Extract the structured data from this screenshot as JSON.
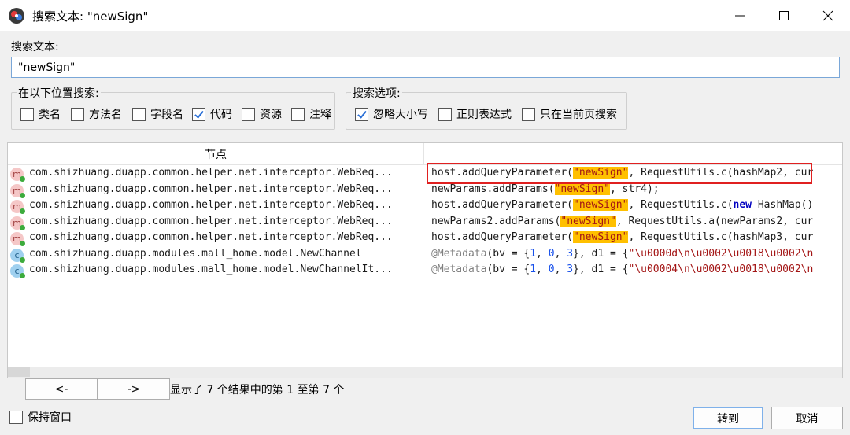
{
  "window": {
    "title": "搜索文本: \"newSign\"",
    "app_icon": "jadx-app-icon",
    "controls": {
      "minimize": "minimize-icon",
      "maximize": "maximize-icon",
      "close": "close-icon"
    }
  },
  "search": {
    "label": "搜索文本:",
    "value": "\"newSign\""
  },
  "location_group": {
    "title": "在以下位置搜索:",
    "options": [
      {
        "label": "类名",
        "checked": false
      },
      {
        "label": "方法名",
        "checked": false
      },
      {
        "label": "字段名",
        "checked": false
      },
      {
        "label": "代码",
        "checked": true
      },
      {
        "label": "资源",
        "checked": false
      },
      {
        "label": "注释",
        "checked": false
      }
    ]
  },
  "options_group": {
    "title": "搜索选项:",
    "options": [
      {
        "label": "忽略大小写",
        "checked": true
      },
      {
        "label": "正则表达式",
        "checked": false
      },
      {
        "label": "只在当前页搜索",
        "checked": false
      }
    ]
  },
  "results": {
    "header_node": "节点",
    "header_code": "",
    "rows": [
      {
        "icon": "m",
        "node": "com.shizhuang.duapp.common.helper.net.interceptor.WebReq...",
        "code": [
          [
            "",
            "host.addQueryParameter("
          ],
          [
            "hl",
            "\"newSign\""
          ],
          [
            "",
            ", RequestUtils.c(hashMap2, cur"
          ]
        ]
      },
      {
        "icon": "m",
        "node": "com.shizhuang.duapp.common.helper.net.interceptor.WebReq...",
        "code": [
          [
            "",
            "newParams.addParams("
          ],
          [
            "hl",
            "\"newSign\""
          ],
          [
            "",
            ", str4);"
          ]
        ]
      },
      {
        "icon": "m",
        "node": "com.shizhuang.duapp.common.helper.net.interceptor.WebReq...",
        "code": [
          [
            "",
            "host.addQueryParameter("
          ],
          [
            "hl",
            "\"newSign\""
          ],
          [
            "",
            ", RequestUtils.c("
          ],
          [
            "kw",
            "new"
          ],
          [
            "",
            " HashMap()"
          ]
        ]
      },
      {
        "icon": "m",
        "node": "com.shizhuang.duapp.common.helper.net.interceptor.WebReq...",
        "code": [
          [
            "",
            "newParams2.addParams("
          ],
          [
            "hl",
            "\"newSign\""
          ],
          [
            "",
            ", RequestUtils.a(newParams2, cur"
          ]
        ]
      },
      {
        "icon": "m",
        "node": "com.shizhuang.duapp.common.helper.net.interceptor.WebReq...",
        "code": [
          [
            "",
            "host.addQueryParameter("
          ],
          [
            "hl",
            "\"newSign\""
          ],
          [
            "",
            ", RequestUtils.c(hashMap3, cur"
          ]
        ]
      },
      {
        "icon": "c",
        "node": "com.shizhuang.duapp.modules.mall_home.model.NewChannel",
        "code": [
          [
            "ann",
            "@Metadata"
          ],
          [
            "",
            "(bv = {"
          ],
          [
            "num",
            "1"
          ],
          [
            "",
            ", "
          ],
          [
            "num",
            "0"
          ],
          [
            "",
            ", "
          ],
          [
            "num",
            "3"
          ],
          [
            "",
            "}, d1 = {"
          ],
          [
            "str",
            "\"\\u0000d\\n\\u0002\\u0018\\u0002\\n"
          ]
        ]
      },
      {
        "icon": "c",
        "node": "com.shizhuang.duapp.modules.mall_home.model.NewChannelIt...",
        "code": [
          [
            "ann",
            "@Metadata"
          ],
          [
            "",
            "(bv = {"
          ],
          [
            "num",
            "1"
          ],
          [
            "",
            ", "
          ],
          [
            "num",
            "0"
          ],
          [
            "",
            ", "
          ],
          [
            "num",
            "3"
          ],
          [
            "",
            "}, d1 = {"
          ],
          [
            "str",
            "\"\\u00004\\n\\u0002\\u0018\\u0002\\n"
          ]
        ]
      }
    ]
  },
  "pagination": {
    "prev_label": "<-",
    "next_label": "->",
    "status": "显示了 7 个结果中的第 1 至第 7 个"
  },
  "footer": {
    "keep_window_label": "保持窗口",
    "keep_window_checked": false,
    "goto_label": "转到",
    "cancel_label": "取消"
  }
}
